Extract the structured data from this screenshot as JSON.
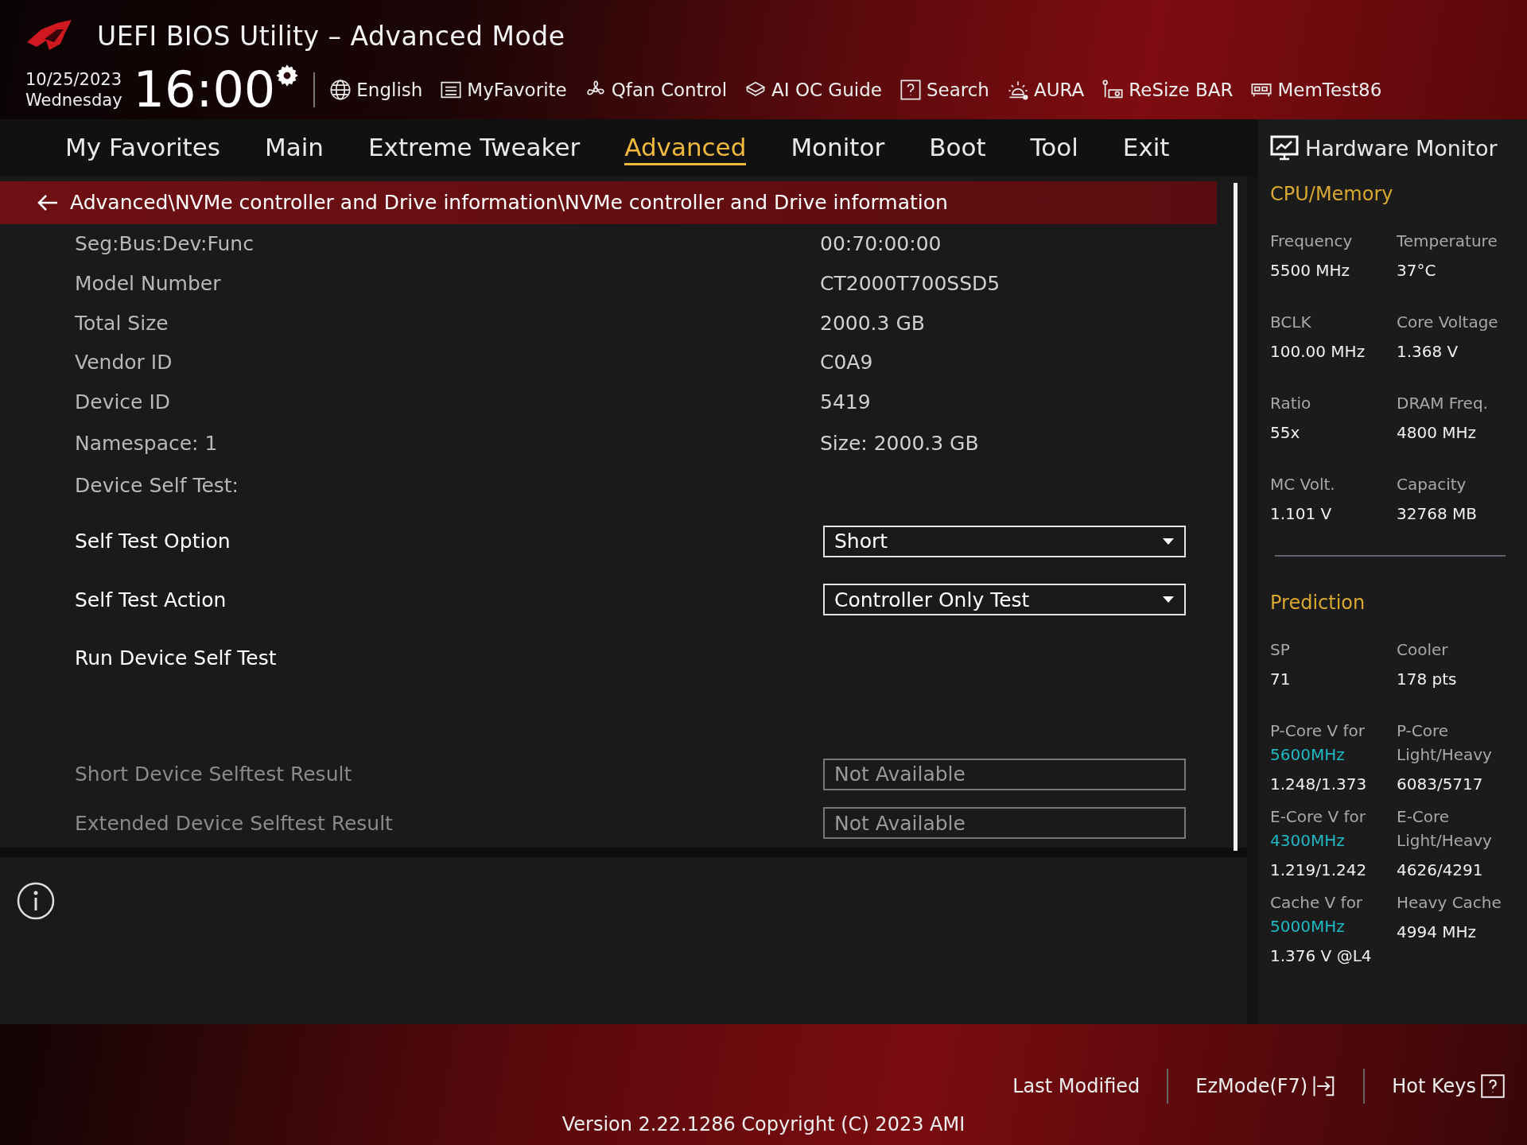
{
  "header": {
    "title": "UEFI BIOS Utility – Advanced Mode",
    "date": "10/25/2023",
    "weekday": "Wednesday",
    "time": "16:00",
    "tools": [
      {
        "kind": "globe",
        "label": "English"
      },
      {
        "kind": "list",
        "label": "MyFavorite"
      },
      {
        "kind": "fan",
        "label": "Qfan Control"
      },
      {
        "kind": "chip",
        "label": "AI OC Guide"
      },
      {
        "kind": "help",
        "label": "Search"
      },
      {
        "kind": "light",
        "label": "AURA"
      },
      {
        "kind": "card",
        "label": "ReSize BAR"
      },
      {
        "kind": "memory",
        "label": "MemTest86"
      }
    ]
  },
  "tabs": [
    {
      "label": "My Favorites",
      "selected": false
    },
    {
      "label": "Main",
      "selected": false
    },
    {
      "label": "Extreme Tweaker",
      "selected": false
    },
    {
      "label": "Advanced",
      "selected": true
    },
    {
      "label": "Monitor",
      "selected": false
    },
    {
      "label": "Boot",
      "selected": false
    },
    {
      "label": "Tool",
      "selected": false
    },
    {
      "label": "Exit",
      "selected": false
    }
  ],
  "breadcrumb": "Advanced\\NVMe controller and Drive information\\NVMe controller and Drive information",
  "items": [
    {
      "kind": "info",
      "label": "Seg:Bus:Dev:Func",
      "value": "00:70:00:00"
    },
    {
      "kind": "info",
      "label": "Model Number",
      "value": "CT2000T700SSD5"
    },
    {
      "kind": "info",
      "label": "Total Size",
      "value": "2000.3 GB"
    },
    {
      "kind": "info",
      "label": "Vendor ID",
      "value": "C0A9"
    },
    {
      "kind": "info",
      "label": "Device ID",
      "value": "5419"
    },
    {
      "kind": "info",
      "label": "Namespace: 1",
      "value": "Size: 2000.3 GB"
    },
    {
      "kind": "info",
      "label": "Device Self Test:"
    },
    {
      "kind": "dropdown",
      "label": "Self Test Option",
      "value": "Short"
    },
    {
      "kind": "dropdown",
      "label": "Self Test Action",
      "value": "Controller Only Test"
    },
    {
      "kind": "action",
      "label": "Run Device Self Test"
    },
    {
      "kind": "readonly",
      "label": "Short Device Selftest Result",
      "value": "Not Available"
    },
    {
      "kind": "readonly",
      "label": "Extended Device Selftest Result",
      "value": "Not Available"
    }
  ],
  "hardware_monitor": {
    "title": "Hardware Monitor",
    "sections": [
      {
        "title": "CPU/Memory",
        "rows": [
          [
            {
              "label": "Frequency",
              "value": "5500 MHz"
            },
            {
              "label": "Temperature",
              "value": "37°C"
            }
          ],
          [
            {
              "label": "BCLK",
              "value": "100.00 MHz"
            },
            {
              "label": "Core Voltage",
              "value": "1.368 V"
            }
          ],
          [
            {
              "label": "Ratio",
              "value": "55x"
            },
            {
              "label": "DRAM Freq.",
              "value": "4800 MHz"
            }
          ],
          [
            {
              "label": "MC Volt.",
              "value": "1.101 V"
            },
            {
              "label": "Capacity",
              "value": "32768 MB"
            }
          ]
        ]
      },
      {
        "title": "Prediction",
        "rows": [
          [
            {
              "label": "SP",
              "value": "71"
            },
            {
              "label": "Cooler",
              "value": "178 pts"
            }
          ],
          [
            {
              "label": "P-Core V for",
              "highlight": "5600MHz",
              "value": "1.248/1.373"
            },
            {
              "label": "P-Core Light/Heavy",
              "value": "6083/5717"
            }
          ],
          [
            {
              "label": "E-Core V for",
              "highlight": "4300MHz",
              "value": "1.219/1.242"
            },
            {
              "label": "E-Core Light/Heavy",
              "value": "4626/4291"
            }
          ],
          [
            {
              "label": "Cache V for",
              "highlight": "5000MHz",
              "value": "1.376 V @L4"
            },
            {
              "label": "Heavy Cache",
              "value": "4994 MHz"
            }
          ]
        ]
      }
    ]
  },
  "footer": {
    "buttons": [
      {
        "kind": "plain",
        "label": "Last Modified"
      },
      {
        "kind": "exit",
        "label": "EzMode(F7)"
      },
      {
        "kind": "help",
        "label": "Hot Keys"
      }
    ],
    "version": "Version 2.22.1286 Copyright (C) 2023 AMI"
  }
}
